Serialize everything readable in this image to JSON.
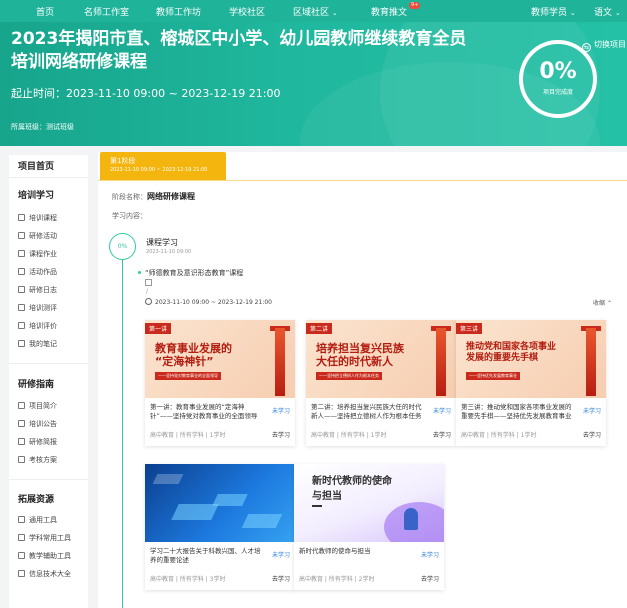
{
  "nav": {
    "items": [
      "首页",
      "名师工作室",
      "教师工作坊",
      "学校社区",
      "区域社区",
      "教育推文"
    ],
    "badge": "9+",
    "user": "教师学员",
    "language": "语文"
  },
  "banner": {
    "title": "2023年揭阳市直、榕城区中小学、幼儿园教师继续教育全员培训网络研修课程",
    "period": "起止时间：2023-11-10 09:00 ~ 2023-12-19 21:00",
    "category": "所属班级：测试班级",
    "switch": "切换项目",
    "progress": "0%",
    "progress_label": "项目完成度"
  },
  "sidebar": {
    "home": "项目首页",
    "sections": [
      {
        "title": "培训学习",
        "items": [
          "培训课程",
          "研修活动",
          "课程作业",
          "活动作品",
          "研修日志",
          "培训测评",
          "培训评价",
          "我的笔记"
        ]
      },
      {
        "title": "研修指南",
        "items": [
          "项目简介",
          "培训公告",
          "研修简报",
          "考核方案"
        ]
      },
      {
        "title": "拓展资源",
        "items": [
          "通用工具",
          "学科常用工具",
          "教学辅助工具",
          "信息技术大全"
        ]
      }
    ]
  },
  "main": {
    "stage_tab": "第1阶段",
    "stage_tab_range": "2023-11-10 09:00 ~ 2023-12-19 21:00",
    "stage_name_label": "阶段名称：",
    "stage_name": "网络研修课程",
    "study_label": "学习内容：",
    "node_pct": "0%",
    "node_title": "课程学习",
    "node_date": "2023-11-10 09:00",
    "sub_title": "“师德教育及意识形态教育”课程",
    "slash": "/",
    "sub_range": "2023-11-10 09:00 ~ 2023-12-19 21:00",
    "collapse": "收缩"
  },
  "cards": [
    {
      "thumb_tag": "第一讲",
      "thumb_title": "教育事业发展的\n“定海神针”",
      "thumb_sub": "——坚持党对教育事业的全面领导",
      "name": "第一讲：教育事业发展的“定海神针”——坚持党对教育事业的全面领导",
      "status": "未学习",
      "meta": "高中教育 | 所有学科 | 1学时",
      "go": "去学习"
    },
    {
      "thumb_tag": "第二讲",
      "thumb_title": "培养担当复兴民族\n大任的时代新人",
      "thumb_sub": "——坚持把立德树人作为根本任务",
      "name": "第二讲：培养担当复兴民族大任的时代新人——坚持把立德树人作为根本任务",
      "status": "未学习",
      "meta": "高中教育 | 所有学科 | 1学时",
      "go": "去学习"
    },
    {
      "thumb_tag": "第三讲",
      "thumb_title": "推动党和国家各项事业\n发展的重要先手棋",
      "thumb_sub": "——坚持优先发展教育事业",
      "name": "第三讲：推动党和国家各项事业发展的重要先手棋——坚持优先发展教育事业",
      "status": "未学习",
      "meta": "高中教育 | 所有学科 | 1学时",
      "go": "去学习"
    },
    {
      "name": "学习二十大报告关于科教兴国、人才培养的重要论述",
      "status": "未学习",
      "meta": "高中教育 | 所有学科 | 3学时",
      "go": "去学习"
    },
    {
      "thumb_title": "新时代教师的使命\n与担当",
      "name": "新时代教师的使命与担当",
      "status": "未学习",
      "meta": "高中教育 | 所有学科 | 2学时",
      "go": "去学习"
    }
  ]
}
